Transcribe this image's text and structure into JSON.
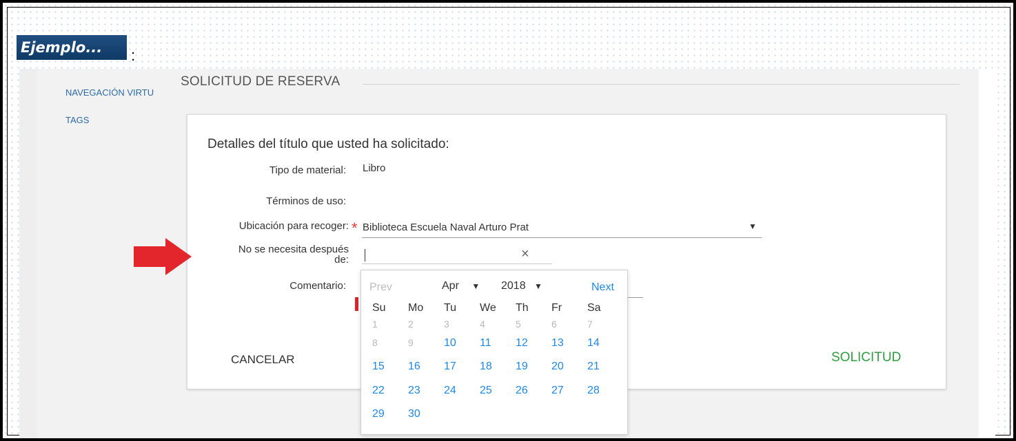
{
  "banner": {
    "label": "Ejemplo...",
    "colon": ":"
  },
  "nav": {
    "items": [
      "NAVEGACIÓN VIRTU",
      "TAGS"
    ]
  },
  "section": {
    "title": "SOLICITUD DE RESERVA"
  },
  "dialog": {
    "heading": "Detalles del título que usted ha solicitado:",
    "fields": {
      "material_label": "Tipo de material:",
      "material_value": "Libro",
      "terms_label": "Términos de uso:",
      "pickup_label": "Ubicación para recoger:",
      "required_mark": "*",
      "pickup_value": "Biblioteca Escuela Naval Arturo Prat",
      "dropdown_glyph": "▼",
      "notneeded_label_1": "No se necesita después",
      "notneeded_label_2": "de:",
      "clear_glyph": "×",
      "comment_label": "Comentario:"
    },
    "buttons": {
      "cancel": "CANCELAR",
      "submit": "SOLICITUD"
    }
  },
  "calendar": {
    "prev": "Prev",
    "next": "Next",
    "month": "Apr",
    "year": "2018",
    "dropdown_glyph": "▼",
    "weekdays": [
      "Su",
      "Mo",
      "Tu",
      "We",
      "Th",
      "Fr",
      "Sa"
    ],
    "weeks": [
      [
        "1",
        "2",
        "3",
        "4",
        "5",
        "6",
        "7"
      ],
      [
        "8",
        "9",
        "10",
        "11",
        "12",
        "13",
        "14"
      ],
      [
        "15",
        "16",
        "17",
        "18",
        "19",
        "20",
        "21"
      ],
      [
        "22",
        "23",
        "24",
        "25",
        "26",
        "27",
        "28"
      ],
      [
        "29",
        "30"
      ]
    ],
    "first_selectable_day": "10"
  },
  "colors": {
    "accent": "#1e88e5",
    "submit": "#2e9e3f",
    "required": "#e53935",
    "arrow": "#e3262c",
    "banner": "#1f4e80"
  },
  "icons": [
    "red-arrow-icon",
    "dropdown-caret-icon",
    "clear-icon"
  ]
}
